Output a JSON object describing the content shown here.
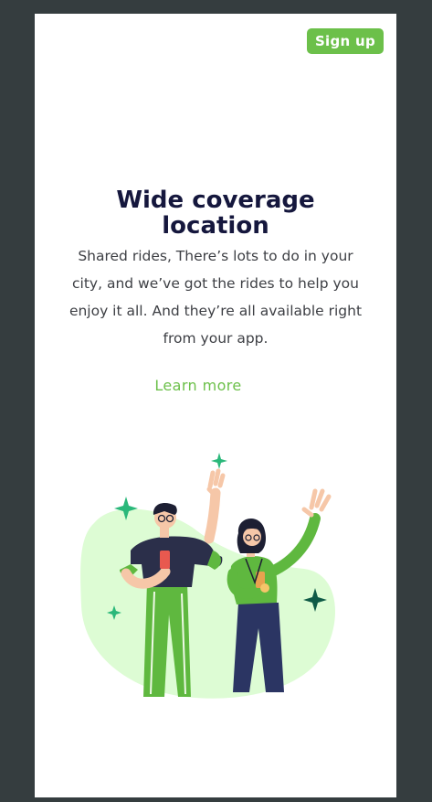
{
  "header": {
    "signup_label": "Sign up"
  },
  "hero": {
    "title_line1": "Wide coverage",
    "title_line2": "location",
    "description": "Shared rides, There’s lots to do in your city, and we’ve got the rides to help you enjoy it all. And they’re all available right from your app.",
    "learn_more_label": "Learn more"
  },
  "illustration": {
    "description_icon": "two-people-waving-illustration"
  },
  "colors": {
    "accent_green": "#6cc04a",
    "title_navy": "#15173d",
    "blob_light_green": "#ddfcd4",
    "background_dark": "#353d3f"
  }
}
